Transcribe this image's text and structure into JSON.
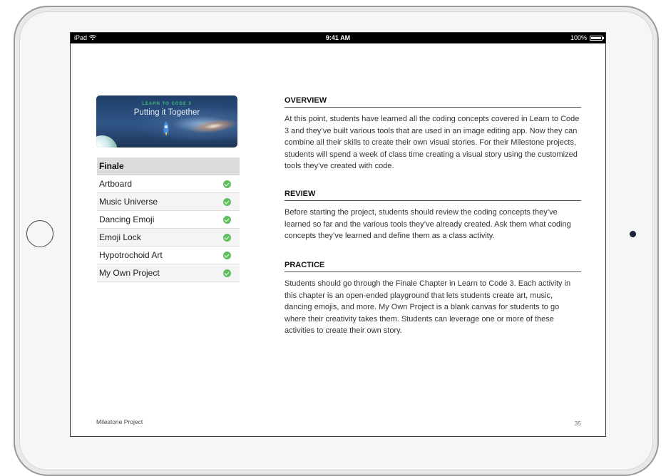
{
  "status_bar": {
    "device": "iPad",
    "time": "9:41 AM",
    "battery": "100%"
  },
  "hero": {
    "kicker": "LEARN TO CODE 3",
    "title": "Putting it Together"
  },
  "chapter": {
    "header": "Finale",
    "items": [
      {
        "label": "Artboard",
        "status": "complete"
      },
      {
        "label": "Music Universe",
        "status": "complete"
      },
      {
        "label": "Dancing Emoji",
        "status": "complete"
      },
      {
        "label": "Emoji Lock",
        "status": "complete"
      },
      {
        "label": "Hypotrochoid Art",
        "status": "complete"
      },
      {
        "label": "My Own Project",
        "status": "complete"
      }
    ]
  },
  "sections": {
    "overview": {
      "heading": "OVERVIEW",
      "body": "At this point, students have learned all the coding concepts covered in Learn to Code 3 and they’ve built various tools that are used in an image editing app. Now they can combine all their skills to create their own visual stories. For their Milestone projects, students will spend a week of class time creating a visual story using the customized tools they’ve created with code."
    },
    "review": {
      "heading": "REVIEW",
      "body": "Before starting the project, students should review the coding concepts they’ve learned so far and the various tools they’ve already created. Ask them what coding concepts they’ve learned and define them as a class activity."
    },
    "practice": {
      "heading": "PRACTICE",
      "body": "Students should go through the Finale Chapter in Learn to Code 3. Each activity in this chapter is an open-ended playground that lets students create art, music, dancing emojis, and more. My Own Project is a blank canvas for students to go where their creativity takes them. Students can leverage one or more of these activities to create their own story."
    }
  },
  "footer": {
    "left": "Milestone Project",
    "page_number": "35"
  },
  "colors": {
    "check_green": "#5fbf5f",
    "kicker_green": "#3fbf7a",
    "status_bar": "#000000"
  }
}
